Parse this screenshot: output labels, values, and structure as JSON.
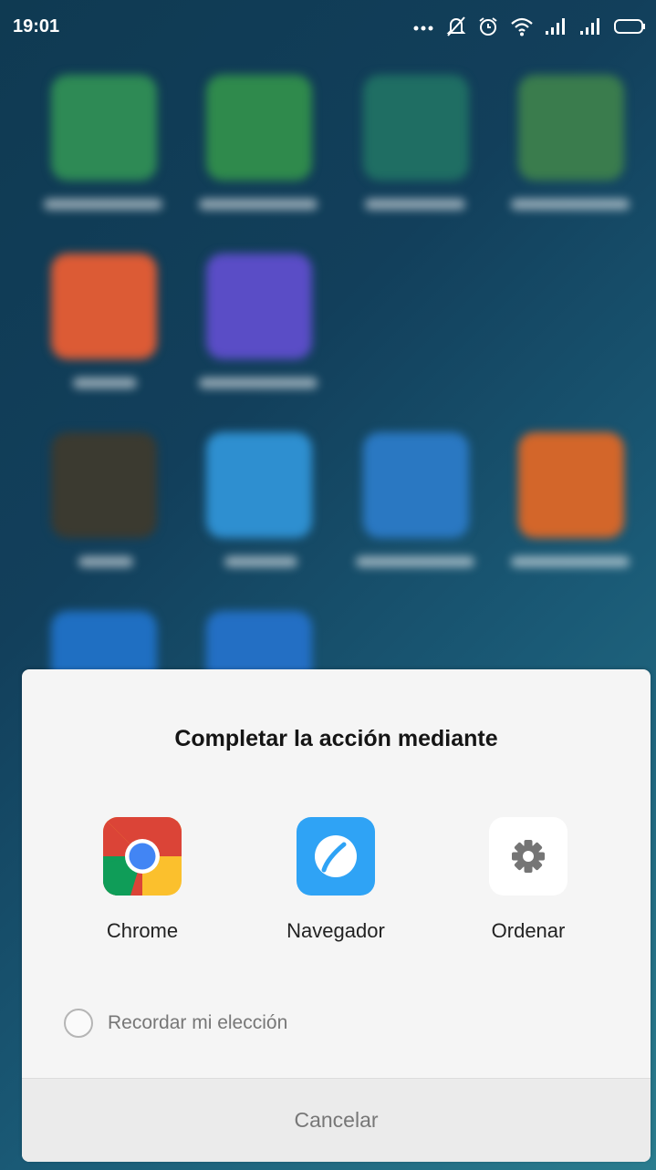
{
  "status_bar": {
    "time": "19:01",
    "icons": [
      "more-dots-icon",
      "bell-off-icon",
      "alarm-icon",
      "wifi-icon",
      "signal-icon",
      "signal-icon",
      "battery-icon"
    ]
  },
  "dialog": {
    "title": "Completar la acción mediante",
    "options": [
      {
        "label": "Chrome",
        "icon": "chrome-icon"
      },
      {
        "label": "Navegador",
        "icon": "browser-icon"
      },
      {
        "label": "Ordenar",
        "icon": "gear-icon"
      }
    ],
    "remember_label": "Recordar mi elección",
    "remember_checked": false,
    "cancel_label": "Cancelar"
  },
  "colors": {
    "sheet_background": "#f5f5f5",
    "cancel_background": "#ebebeb",
    "title_text": "#151515",
    "secondary_text": "#777777"
  }
}
